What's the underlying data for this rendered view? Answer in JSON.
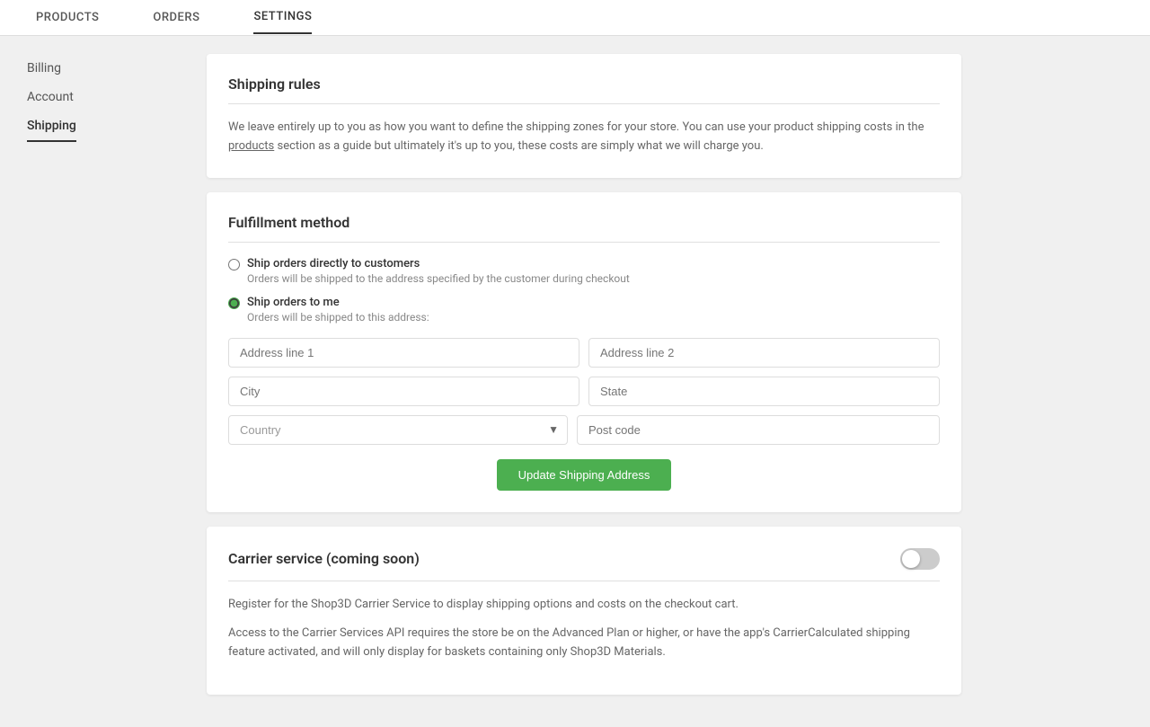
{
  "nav": {
    "items": [
      {
        "label": "PRODUCTS",
        "active": false
      },
      {
        "label": "ORDERS",
        "active": false
      },
      {
        "label": "SETTINGS",
        "active": true
      }
    ]
  },
  "sidebar": {
    "items": [
      {
        "label": "Billing",
        "active": false
      },
      {
        "label": "Account",
        "active": false
      },
      {
        "label": "Shipping",
        "active": true
      }
    ]
  },
  "shipping_rules": {
    "title": "Shipping rules",
    "description_1": "We leave entirely up to you as how you want to define the shipping zones for your store. You can use your product shipping costs in the ",
    "description_link": "products",
    "description_2": " section as a guide but ultimately it's up to you, these costs are simply what we will charge you."
  },
  "fulfillment": {
    "title": "Fulfillment method",
    "option1": {
      "label": "Ship orders directly to customers",
      "sublabel": "Orders will be shipped to the address specified by the customer during checkout"
    },
    "option2": {
      "label": "Ship orders to me",
      "sublabel": "Orders will be shipped to this address:"
    },
    "address": {
      "line1_placeholder": "Address line 1",
      "line2_placeholder": "Address line 2",
      "city_placeholder": "City",
      "state_placeholder": "State",
      "country_placeholder": "Country",
      "postcode_placeholder": "Post code"
    },
    "update_button": "Update Shipping Address"
  },
  "carrier": {
    "title": "Carrier service (coming soon)",
    "description1": "Register for the Shop3D Carrier Service to display shipping options and costs on the checkout cart.",
    "description2": "Access to the Carrier Services API requires the store be on the Advanced Plan or higher, or have the app's CarrierCalculated shipping feature activated, and will only display for baskets containing only Shop3D Materials.",
    "enabled": false
  },
  "colors": {
    "active_green": "#4CAF50",
    "nav_underline": "#333"
  }
}
